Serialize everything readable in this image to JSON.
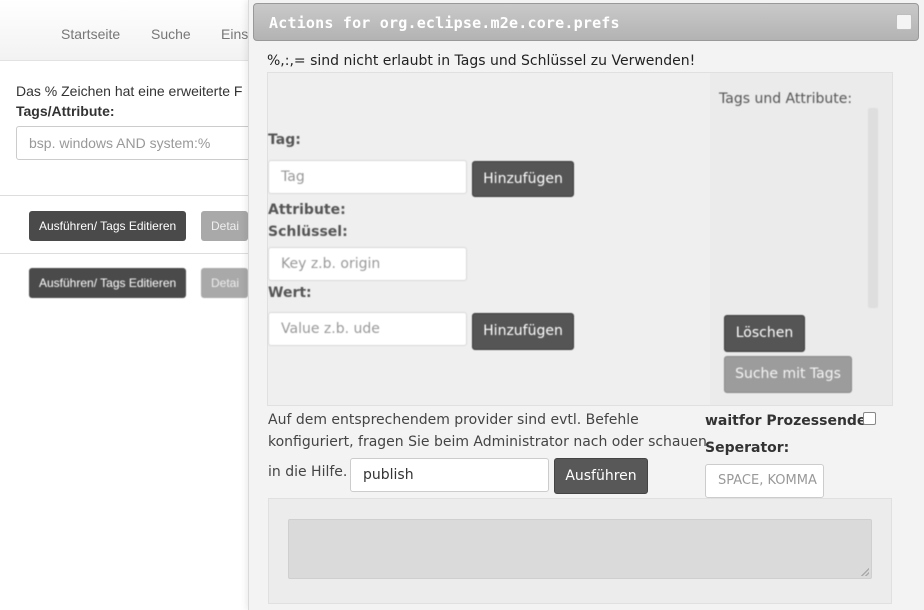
{
  "background": {
    "nav": [
      "Startseite",
      "Suche",
      "Eins"
    ],
    "notice": "Das % Zeichen hat eine erweiterte F",
    "tags_label": "Tags/Attribute:",
    "search_placeholder": "bsp. windows AND system:%",
    "buttons_row1": [
      "Ausführen/ Tags Editieren",
      "Detai"
    ],
    "buttons_row2": [
      "Ausführen/ Tags Editieren",
      "Detai"
    ]
  },
  "dialog": {
    "title": "Actions for org.eclipse.m2e.core.prefs",
    "warning": "%,:,= sind nicht erlaubt in Tags und Schlüssel zu Verwenden!",
    "tags_and_attributes_label": "Tags und Attribute:",
    "tag_label": "Tag:",
    "tag_placeholder": "Tag",
    "add_tag_button": "Hinzufügen",
    "attribute_label": "Attribute:",
    "key_label": "Schlüssel:",
    "key_placeholder": "Key z.b. origin",
    "value_label": "Wert:",
    "value_placeholder": "Value z.b. ude",
    "add_attribute_button": "Hinzufügen",
    "delete_button": "Löschen",
    "search_with_tags_button": "Suche mit Tags",
    "info_line1": "Auf dem entsprechendem provider sind evtl. Befehle",
    "info_line2": "konfiguriert, fragen Sie beim Administrator nach oder schauen",
    "info_line3": "in die Hilfe.",
    "command_value": "publish",
    "run_button": "Ausführen",
    "waitfor_label": "waitfor Prozessende:",
    "separator_label": "Seperator:",
    "separator_placeholder": "SPACE, KOMMA"
  }
}
